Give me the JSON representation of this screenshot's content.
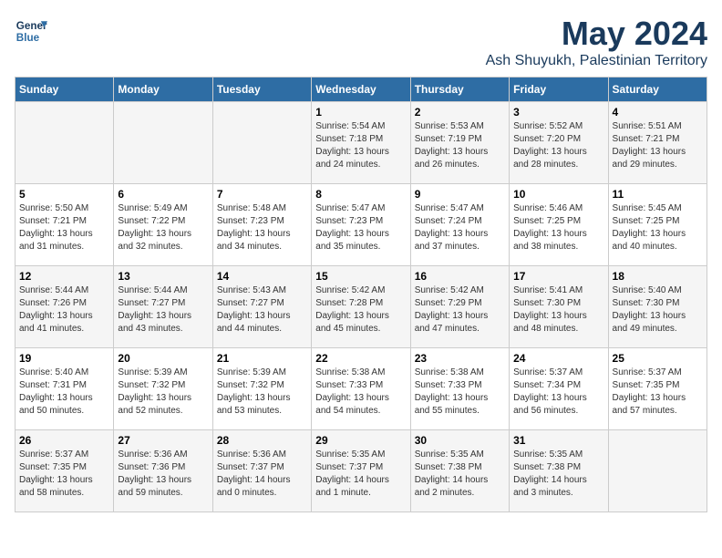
{
  "logo": {
    "line1": "General",
    "line2": "Blue"
  },
  "title": "May 2024",
  "location": "Ash Shuyukh, Palestinian Territory",
  "days_of_week": [
    "Sunday",
    "Monday",
    "Tuesday",
    "Wednesday",
    "Thursday",
    "Friday",
    "Saturday"
  ],
  "weeks": [
    [
      {
        "day": "",
        "info": ""
      },
      {
        "day": "",
        "info": ""
      },
      {
        "day": "",
        "info": ""
      },
      {
        "day": "1",
        "info": "Sunrise: 5:54 AM\nSunset: 7:18 PM\nDaylight: 13 hours\nand 24 minutes."
      },
      {
        "day": "2",
        "info": "Sunrise: 5:53 AM\nSunset: 7:19 PM\nDaylight: 13 hours\nand 26 minutes."
      },
      {
        "day": "3",
        "info": "Sunrise: 5:52 AM\nSunset: 7:20 PM\nDaylight: 13 hours\nand 28 minutes."
      },
      {
        "day": "4",
        "info": "Sunrise: 5:51 AM\nSunset: 7:21 PM\nDaylight: 13 hours\nand 29 minutes."
      }
    ],
    [
      {
        "day": "5",
        "info": "Sunrise: 5:50 AM\nSunset: 7:21 PM\nDaylight: 13 hours\nand 31 minutes."
      },
      {
        "day": "6",
        "info": "Sunrise: 5:49 AM\nSunset: 7:22 PM\nDaylight: 13 hours\nand 32 minutes."
      },
      {
        "day": "7",
        "info": "Sunrise: 5:48 AM\nSunset: 7:23 PM\nDaylight: 13 hours\nand 34 minutes."
      },
      {
        "day": "8",
        "info": "Sunrise: 5:47 AM\nSunset: 7:23 PM\nDaylight: 13 hours\nand 35 minutes."
      },
      {
        "day": "9",
        "info": "Sunrise: 5:47 AM\nSunset: 7:24 PM\nDaylight: 13 hours\nand 37 minutes."
      },
      {
        "day": "10",
        "info": "Sunrise: 5:46 AM\nSunset: 7:25 PM\nDaylight: 13 hours\nand 38 minutes."
      },
      {
        "day": "11",
        "info": "Sunrise: 5:45 AM\nSunset: 7:25 PM\nDaylight: 13 hours\nand 40 minutes."
      }
    ],
    [
      {
        "day": "12",
        "info": "Sunrise: 5:44 AM\nSunset: 7:26 PM\nDaylight: 13 hours\nand 41 minutes."
      },
      {
        "day": "13",
        "info": "Sunrise: 5:44 AM\nSunset: 7:27 PM\nDaylight: 13 hours\nand 43 minutes."
      },
      {
        "day": "14",
        "info": "Sunrise: 5:43 AM\nSunset: 7:27 PM\nDaylight: 13 hours\nand 44 minutes."
      },
      {
        "day": "15",
        "info": "Sunrise: 5:42 AM\nSunset: 7:28 PM\nDaylight: 13 hours\nand 45 minutes."
      },
      {
        "day": "16",
        "info": "Sunrise: 5:42 AM\nSunset: 7:29 PM\nDaylight: 13 hours\nand 47 minutes."
      },
      {
        "day": "17",
        "info": "Sunrise: 5:41 AM\nSunset: 7:30 PM\nDaylight: 13 hours\nand 48 minutes."
      },
      {
        "day": "18",
        "info": "Sunrise: 5:40 AM\nSunset: 7:30 PM\nDaylight: 13 hours\nand 49 minutes."
      }
    ],
    [
      {
        "day": "19",
        "info": "Sunrise: 5:40 AM\nSunset: 7:31 PM\nDaylight: 13 hours\nand 50 minutes."
      },
      {
        "day": "20",
        "info": "Sunrise: 5:39 AM\nSunset: 7:32 PM\nDaylight: 13 hours\nand 52 minutes."
      },
      {
        "day": "21",
        "info": "Sunrise: 5:39 AM\nSunset: 7:32 PM\nDaylight: 13 hours\nand 53 minutes."
      },
      {
        "day": "22",
        "info": "Sunrise: 5:38 AM\nSunset: 7:33 PM\nDaylight: 13 hours\nand 54 minutes."
      },
      {
        "day": "23",
        "info": "Sunrise: 5:38 AM\nSunset: 7:33 PM\nDaylight: 13 hours\nand 55 minutes."
      },
      {
        "day": "24",
        "info": "Sunrise: 5:37 AM\nSunset: 7:34 PM\nDaylight: 13 hours\nand 56 minutes."
      },
      {
        "day": "25",
        "info": "Sunrise: 5:37 AM\nSunset: 7:35 PM\nDaylight: 13 hours\nand 57 minutes."
      }
    ],
    [
      {
        "day": "26",
        "info": "Sunrise: 5:37 AM\nSunset: 7:35 PM\nDaylight: 13 hours\nand 58 minutes."
      },
      {
        "day": "27",
        "info": "Sunrise: 5:36 AM\nSunset: 7:36 PM\nDaylight: 13 hours\nand 59 minutes."
      },
      {
        "day": "28",
        "info": "Sunrise: 5:36 AM\nSunset: 7:37 PM\nDaylight: 14 hours\nand 0 minutes."
      },
      {
        "day": "29",
        "info": "Sunrise: 5:35 AM\nSunset: 7:37 PM\nDaylight: 14 hours\nand 1 minute."
      },
      {
        "day": "30",
        "info": "Sunrise: 5:35 AM\nSunset: 7:38 PM\nDaylight: 14 hours\nand 2 minutes."
      },
      {
        "day": "31",
        "info": "Sunrise: 5:35 AM\nSunset: 7:38 PM\nDaylight: 14 hours\nand 3 minutes."
      },
      {
        "day": "",
        "info": ""
      }
    ]
  ]
}
